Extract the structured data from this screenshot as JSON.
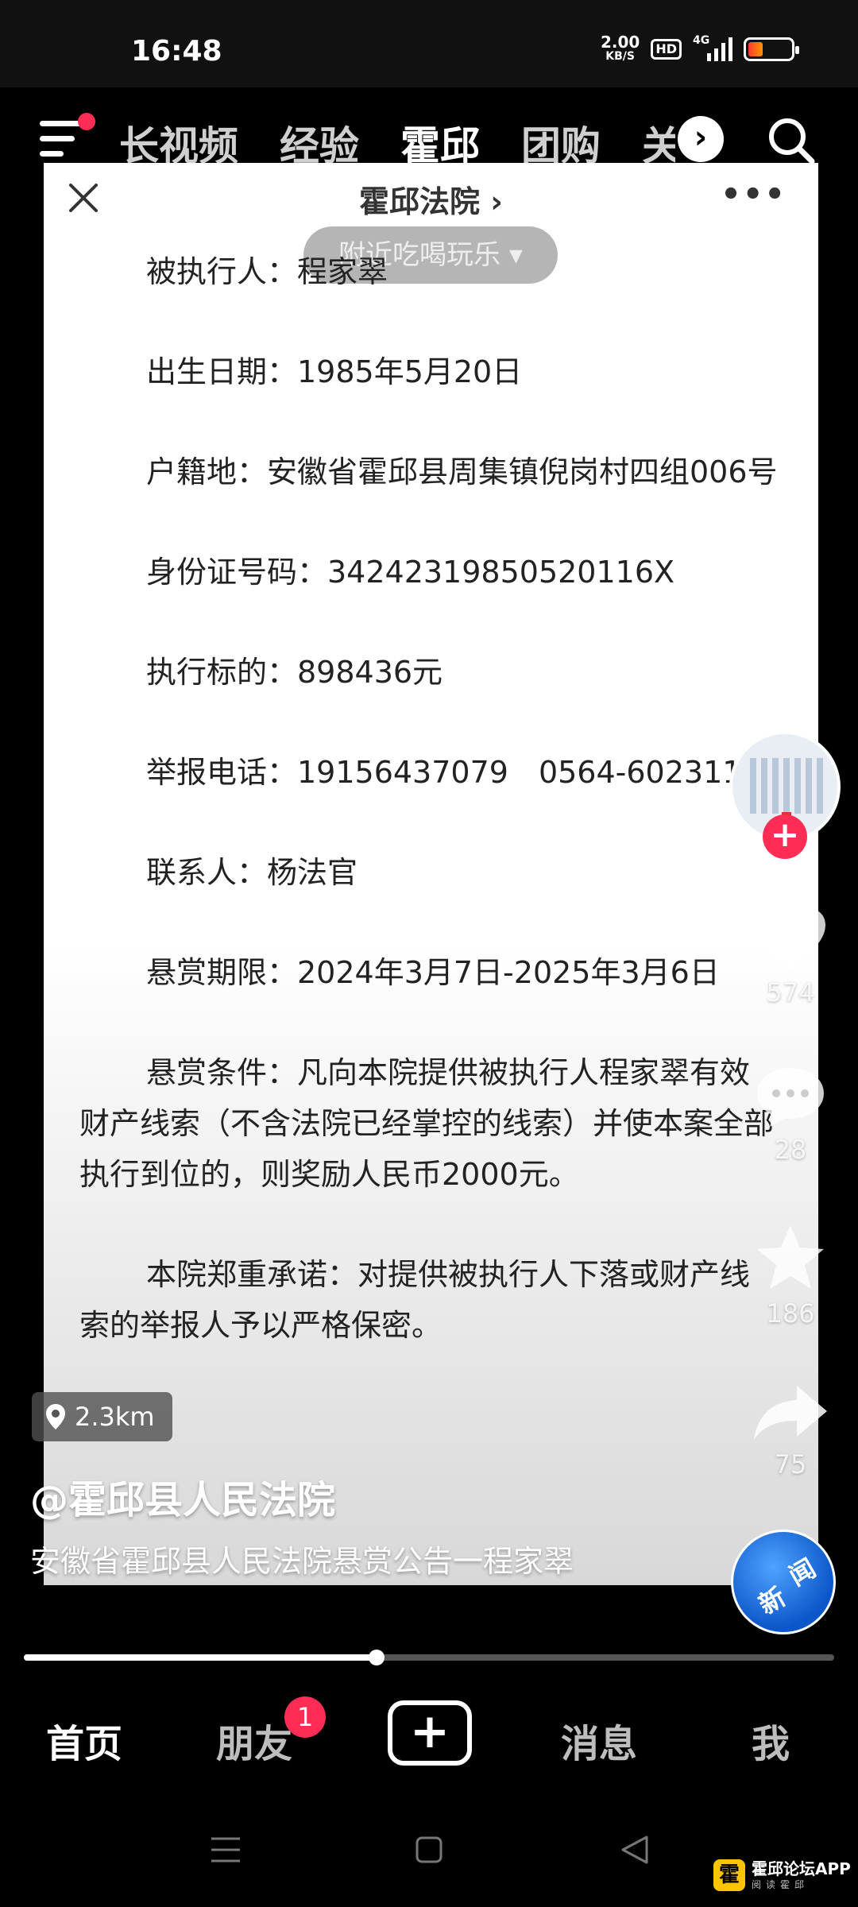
{
  "status_bar": {
    "time": "16:48",
    "net_speed": "2.00",
    "net_unit": "KB/S",
    "hd_label": "HD",
    "network": "4G",
    "battery_level": 0.35
  },
  "top_nav": {
    "channels": [
      "长视频",
      "经验",
      "霍邱",
      "团购",
      "关"
    ],
    "active_channel": "霍邱",
    "more_arrow": "›"
  },
  "video": {
    "header_title": "霍邱法院 ›",
    "more_dots": "•••",
    "nearby_chip": "附近吃喝玩乐 ▾",
    "document": [
      "被执行人：程家翠",
      "出生日期：1985年5月20日",
      "户籍地：安徽省霍邱县周集镇倪岗村四组006号",
      "身份证号码：34242319850520116X",
      "执行标的：898436元",
      "举报电话：19156437079　0564-6023113",
      "联系人：杨法官",
      "悬赏期限：2024年3月7日-2025年3月6日",
      "悬赏条件：凡向本院提供被执行人程家翠有效财产线索（不含法院已经掌控的线索）并使本案全部执行到位的，则奖励人民币2000元。",
      "本院郑重承诺：对提供被执行人下落或财产线索的举报人予以严格保密。"
    ]
  },
  "actions": {
    "follow": "+",
    "likes": "574",
    "comments": "28",
    "favorites": "186",
    "shares": "75"
  },
  "overlay": {
    "location": "2.3km",
    "author": "@霍邱县人民法院",
    "description": "安徽省霍邱县人民法院悬赏公告一程家翠",
    "news_badge": [
      "新",
      "闻"
    ]
  },
  "progress": {
    "played_fraction": 0.435
  },
  "bottom_nav": {
    "home": "首页",
    "friends": "朋友",
    "friends_badge": "1",
    "create": "+",
    "messages": "消息",
    "me": "我"
  },
  "watermark": {
    "logo": "霍",
    "text": "霍邱论坛APP",
    "sub": "阅读霍邱"
  },
  "colors": {
    "accent": "#ff2d55",
    "background": "#000000"
  }
}
